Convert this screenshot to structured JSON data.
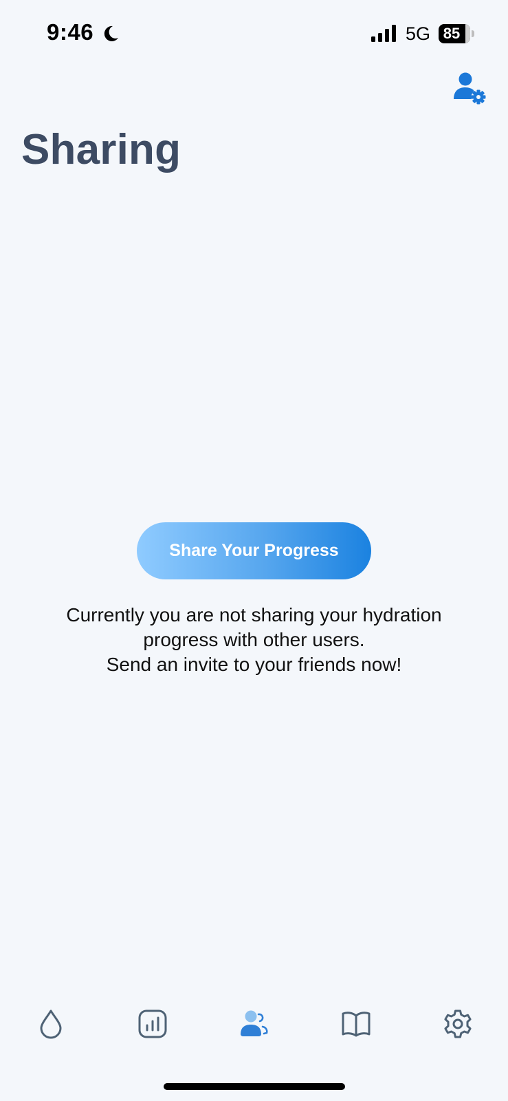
{
  "status_bar": {
    "time": "9:46",
    "network": "5G",
    "battery_percent": "85",
    "battery_level": 0.85,
    "icons": [
      "moon-icon",
      "cellular-signal-icon",
      "battery-icon"
    ]
  },
  "header": {
    "title": "Sharing",
    "account_icon": "person-gear-icon"
  },
  "main": {
    "share_button_label": "Share Your Progress",
    "message": {
      "line1": "Currently you are not sharing your hydration",
      "line2": "progress with other users.",
      "line3": "Send an invite to your friends now!"
    }
  },
  "tab_bar": {
    "selected": "sharing",
    "tabs": [
      {
        "id": "water",
        "icon": "water-drop-icon"
      },
      {
        "id": "statistics",
        "icon": "bar-chart-icon"
      },
      {
        "id": "sharing",
        "icon": "people-sharing-icon"
      },
      {
        "id": "learn",
        "icon": "open-book-icon"
      },
      {
        "id": "settings",
        "icon": "gear-icon"
      }
    ]
  },
  "colors": {
    "background": "#f4f7fb",
    "title": "#3d4b63",
    "accent": "#1b82e0",
    "button_gradient_start": "#8fcbff",
    "button_gradient_end": "#1b82e0",
    "tab_icon_inactive": "#4e6275",
    "tab_icon_active": "#2f7fd6"
  }
}
